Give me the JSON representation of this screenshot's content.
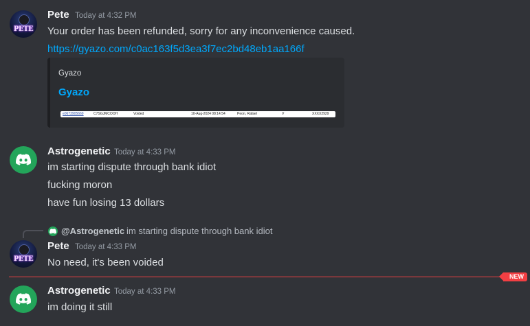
{
  "messages": [
    {
      "author": "Pete",
      "time": "Today at 4:32 PM",
      "lines": [
        "Your order has been refunded, sorry for any inconvenience caused.",
        "https://gyazo.com/c0ac163f5d3ea3f7ec2bd48eb1aa166f"
      ],
      "embed": {
        "provider": "Gyazo",
        "title": "Gyazo",
        "image_row": [
          "e0673905669",
          "C7SGJMCOOH",
          "Voided",
          "10-Aug-2024 08:14:54",
          "Peon, Rafael",
          "V",
          "XXXX2929"
        ]
      }
    },
    {
      "author": "Astrogenetic",
      "time": "Today at 4:33 PM",
      "lines": [
        "im starting dispute through bank idiot",
        "fucking moron",
        "have fun losing 13 dollars"
      ]
    },
    {
      "reply": {
        "name": "@Astrogenetic",
        "text": "im starting dispute through bank idiot"
      },
      "author": "Pete",
      "time": "Today at 4:33 PM",
      "lines": [
        "No need, it's been voided"
      ]
    },
    {
      "author": "Astrogenetic",
      "time": "Today at 4:33 PM",
      "lines": [
        "im doing it still"
      ]
    }
  ],
  "divider": {
    "label": "NEW",
    "color": "#f23f43"
  },
  "avatars": {
    "pete": {
      "text": "PETE",
      "icon": "pete-avatar"
    },
    "astrogenetic": {
      "icon": "discord-logo-icon",
      "color": "#23a55a"
    }
  }
}
